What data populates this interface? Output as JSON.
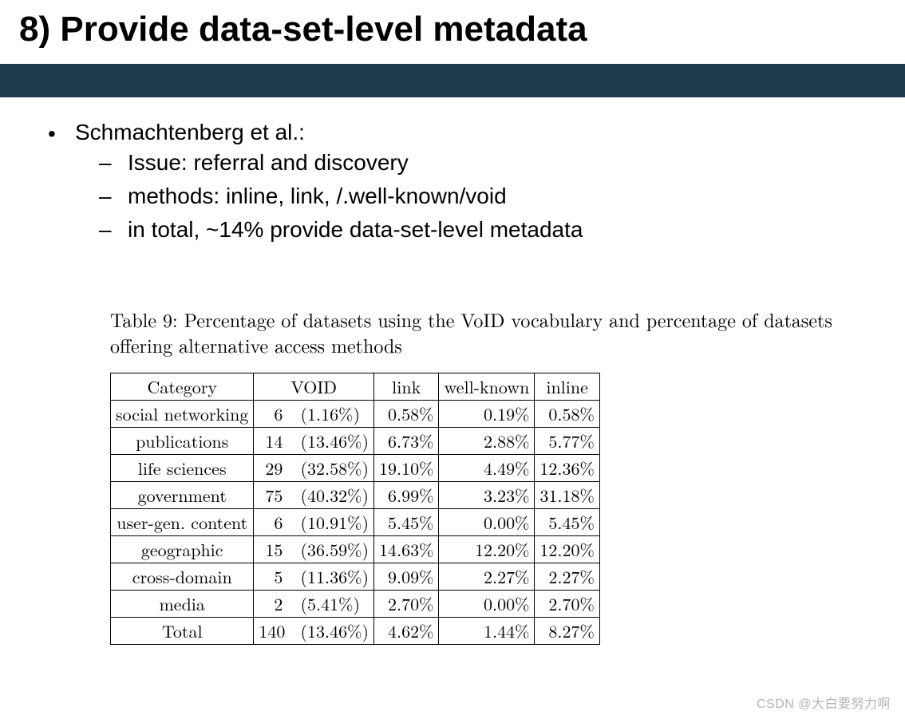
{
  "title": "8) Provide data-set-level metadata",
  "bullets": {
    "main": "Schmachtenberg et al.:",
    "subs": [
      "Issue: referral and discovery",
      "methods: inline, link, /.well-known/void",
      "in total, ~14% provide data-set-level metadata"
    ]
  },
  "table": {
    "caption": "Table 9: Percentage of datasets using the VoID vocabulary and percentage of datasets offering alternative access methods",
    "headers": [
      "Category",
      "VOID",
      "link",
      "well-known",
      "inline"
    ],
    "rows": [
      {
        "cat": "social networking",
        "vn": "6",
        "vp": "(1.16%)",
        "link": "0.58%",
        "wk": "0.19%",
        "inl": "0.58%"
      },
      {
        "cat": "publications",
        "vn": "14",
        "vp": "(13.46%)",
        "link": "6.73%",
        "wk": "2.88%",
        "inl": "5.77%"
      },
      {
        "cat": "life sciences",
        "vn": "29",
        "vp": "(32.58%)",
        "link": "19.10%",
        "wk": "4.49%",
        "inl": "12.36%"
      },
      {
        "cat": "government",
        "vn": "75",
        "vp": "(40.32%)",
        "link": "6.99%",
        "wk": "3.23%",
        "inl": "31.18%"
      },
      {
        "cat": "user-gen. content",
        "vn": "6",
        "vp": "(10.91%)",
        "link": "5.45%",
        "wk": "0.00%",
        "inl": "5.45%"
      },
      {
        "cat": "geographic",
        "vn": "15",
        "vp": "(36.59%)",
        "link": "14.63%",
        "wk": "12.20%",
        "inl": "12.20%"
      },
      {
        "cat": "cross-domain",
        "vn": "5",
        "vp": "(11.36%)",
        "link": "9.09%",
        "wk": "2.27%",
        "inl": "2.27%"
      },
      {
        "cat": "media",
        "vn": "2",
        "vp": "(5.41%)",
        "link": "2.70%",
        "wk": "0.00%",
        "inl": "2.70%"
      }
    ],
    "total": {
      "cat": "Total",
      "vn": "140",
      "vp": "(13.46%)",
      "link": "4.62%",
      "wk": "1.44%",
      "inl": "8.27%"
    }
  },
  "watermark": "CSDN @大白要努力啊",
  "chart_data": {
    "type": "table",
    "title": "Table 9: Percentage of datasets using the VoID vocabulary and percentage of datasets offering alternative access methods",
    "columns": [
      "Category",
      "VOID_count",
      "VOID_pct",
      "link_pct",
      "well-known_pct",
      "inline_pct"
    ],
    "rows": [
      [
        "social networking",
        6,
        1.16,
        0.58,
        0.19,
        0.58
      ],
      [
        "publications",
        14,
        13.46,
        6.73,
        2.88,
        5.77
      ],
      [
        "life sciences",
        29,
        32.58,
        19.1,
        4.49,
        12.36
      ],
      [
        "government",
        75,
        40.32,
        6.99,
        3.23,
        31.18
      ],
      [
        "user-gen. content",
        6,
        10.91,
        5.45,
        0.0,
        5.45
      ],
      [
        "geographic",
        15,
        36.59,
        14.63,
        12.2,
        12.2
      ],
      [
        "cross-domain",
        5,
        11.36,
        9.09,
        2.27,
        2.27
      ],
      [
        "media",
        2,
        5.41,
        2.7,
        0.0,
        2.7
      ],
      [
        "Total",
        140,
        13.46,
        4.62,
        1.44,
        8.27
      ]
    ]
  }
}
